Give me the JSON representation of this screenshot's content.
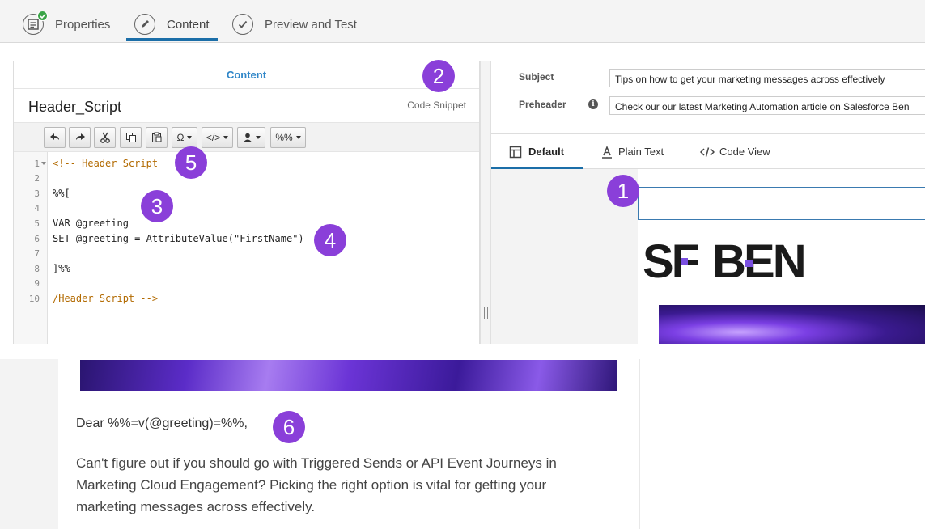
{
  "top_tabs": [
    {
      "label": "Properties",
      "icon": "properties-icon"
    },
    {
      "label": "Content",
      "icon": "pencil-icon"
    },
    {
      "label": "Preview and Test",
      "icon": "check-icon"
    }
  ],
  "content_panel": {
    "header": "Content",
    "block_title": "Header_Script",
    "block_type": "Code Snippet",
    "toolbar": {
      "special_char": "Ω",
      "code": "</>",
      "percent": "%%"
    },
    "code_lines": [
      {
        "n": "1",
        "text": "<!-- Header Script"
      },
      {
        "n": "2",
        "text": ""
      },
      {
        "n": "3",
        "text": "%%["
      },
      {
        "n": "4",
        "text": ""
      },
      {
        "n": "5",
        "text": "VAR @greeting"
      },
      {
        "n": "6",
        "text": "SET @greeting = AttributeValue(\"FirstName\")"
      },
      {
        "n": "7",
        "text": ""
      },
      {
        "n": "8",
        "text": "]%%"
      },
      {
        "n": "9",
        "text": ""
      },
      {
        "n": "10",
        "text": "/Header Script -->"
      }
    ]
  },
  "right_panel": {
    "subject_label": "Subject",
    "subject_value": "Tips on how to get your marketing messages across effectively",
    "preheader_label": "Preheader",
    "preheader_value": "Check our our latest Marketing Automation article on Salesforce Ben",
    "view_tabs": [
      "Default",
      "Plain Text",
      "Code View"
    ],
    "logo_left": "SF",
    "logo_right": "BEN"
  },
  "email_body": {
    "greeting": "Dear %%=v(@greeting)=%%,",
    "paragraph": "Can't figure out if you should go with Triggered Sends or API Event Journeys in Marketing Cloud Engagement? Picking the right option is vital for getting your marketing messages across effectively."
  },
  "markers": [
    "1",
    "2",
    "3",
    "4",
    "5",
    "6"
  ],
  "colors": {
    "accent": "#1b6ea8",
    "marker": "#8a3fd9",
    "content_header": "#2f86c8",
    "comment": "#b26a00"
  }
}
